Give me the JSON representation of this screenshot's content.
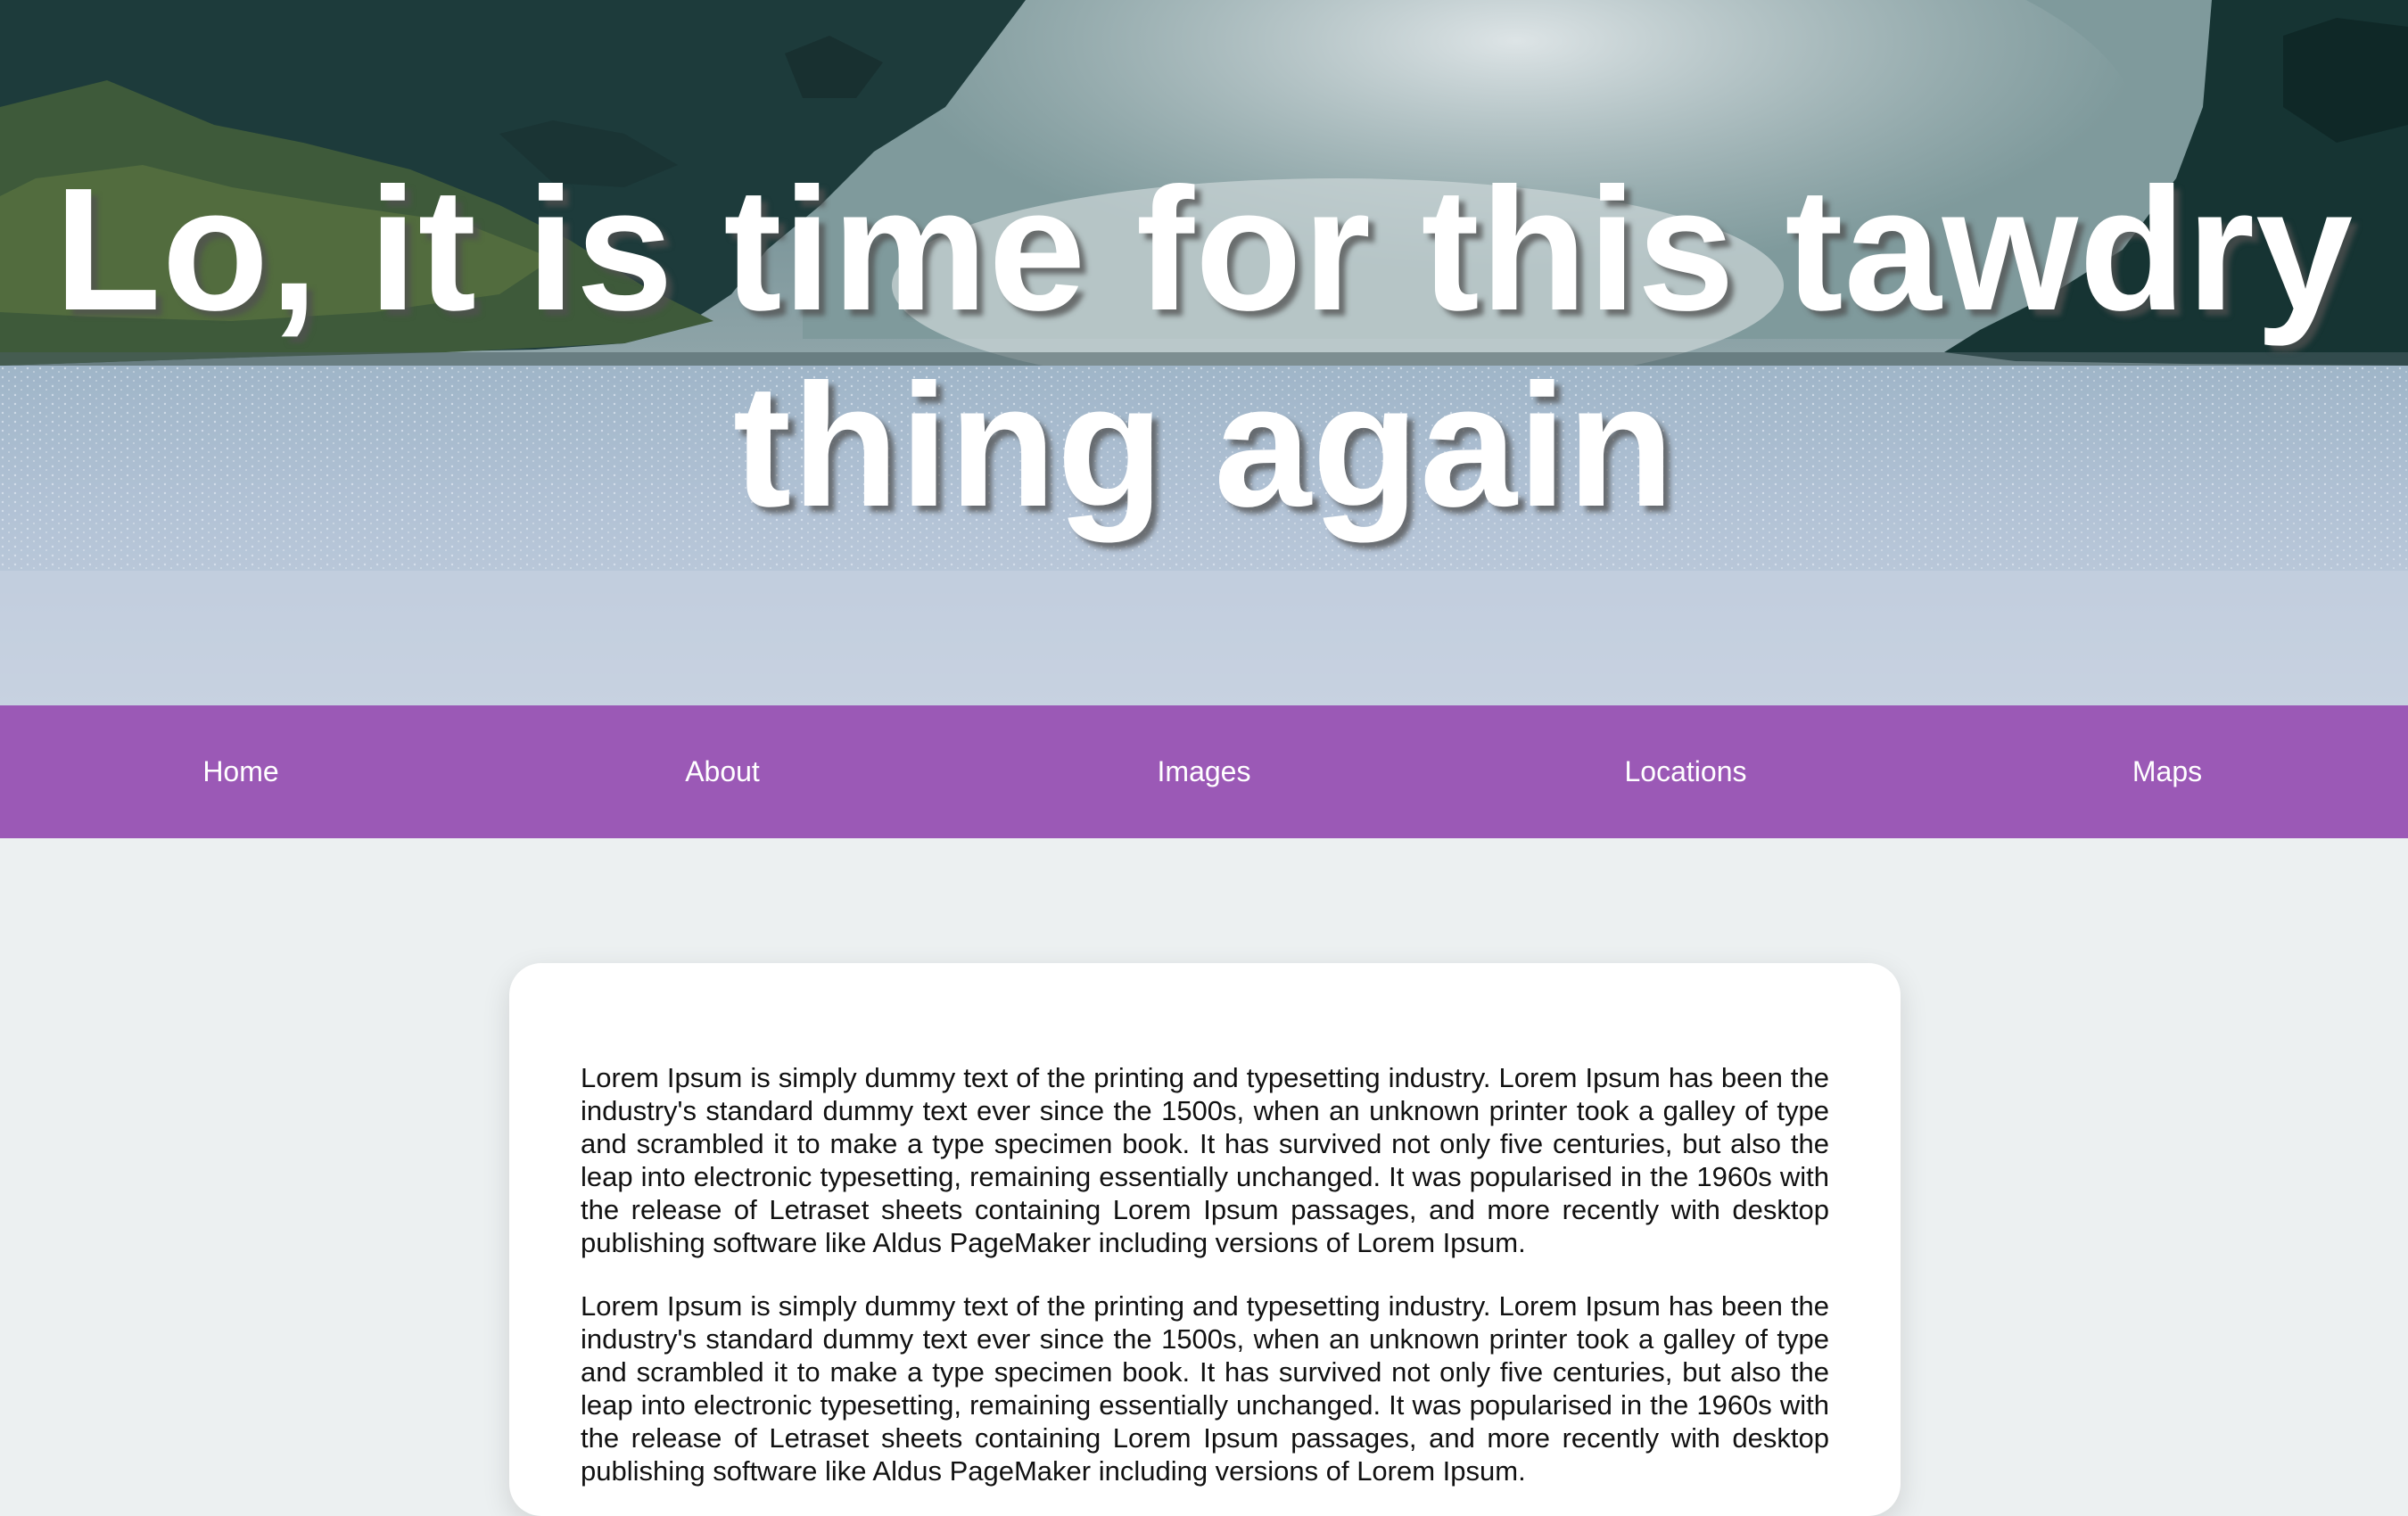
{
  "hero": {
    "title": "Lo, it is time for this tawdry thing again"
  },
  "nav": {
    "items": [
      {
        "label": "Home"
      },
      {
        "label": "About"
      },
      {
        "label": "Images"
      },
      {
        "label": "Locations"
      },
      {
        "label": "Maps"
      }
    ]
  },
  "content": {
    "paragraphs": [
      "Lorem Ipsum is simply dummy text of the printing and typesetting industry. Lorem Ipsum has been the industry's standard dummy text ever since the 1500s, when an unknown printer took a galley of type and scrambled it to make a type specimen book. It has survived not only five centuries, but also the leap into electronic typesetting, remaining essentially unchanged. It was popularised in the 1960s with the release of Letraset sheets containing Lorem Ipsum passages, and more recently with desktop publishing software like Aldus PageMaker including versions of Lorem Ipsum.",
      "Lorem Ipsum is simply dummy text of the printing and typesetting industry. Lorem Ipsum has been the industry's standard dummy text ever since the 1500s, when an unknown printer took a galley of type and scrambled it to make a type specimen book. It has survived not only five centuries, but also the leap into electronic typesetting, remaining essentially unchanged. It was popularised in the 1960s with the release of Letraset sheets containing Lorem Ipsum passages, and more recently with desktop publishing software like Aldus PageMaker including versions of Lorem Ipsum."
    ]
  },
  "colors": {
    "nav_background": "#9b59b6",
    "page_background": "#ecf0f1",
    "card_background": "#ffffff",
    "hero_text": "#ffffff"
  }
}
